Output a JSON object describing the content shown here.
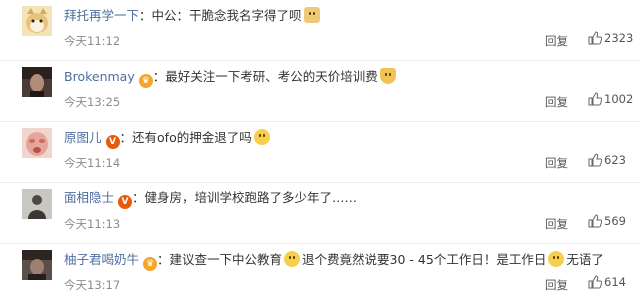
{
  "comments": [
    {
      "user": "拜托再学一下",
      "separator": "：",
      "text": "中公：干脆念我名字得了呗",
      "time": "今天11:12",
      "reply": "回复",
      "likes": "2323"
    },
    {
      "user": "Brokenmay",
      "separator": "：",
      "text": "最好关注一下考研、考公的天价培训费",
      "time": "今天13:25",
      "reply": "回复",
      "likes": "1002"
    },
    {
      "user": "原图儿",
      "separator": "：",
      "text": "还有ofo的押金退了吗",
      "time": "今天11:14",
      "reply": "回复",
      "likes": "623"
    },
    {
      "user": "面相隐士",
      "separator": "：",
      "text": "健身房，培训学校跑路了多少年了……",
      "time": "今天11:13",
      "reply": "回复",
      "likes": "569"
    },
    {
      "user": "柚子君喝奶牛",
      "separator": "：",
      "text_a": "建议查一下中公教育",
      "text_b": "退个费竟然说要30 - 45个工作日！是工作日",
      "text_c": "无语了",
      "time": "今天13:17",
      "reply": "回复",
      "likes": "614"
    }
  ]
}
